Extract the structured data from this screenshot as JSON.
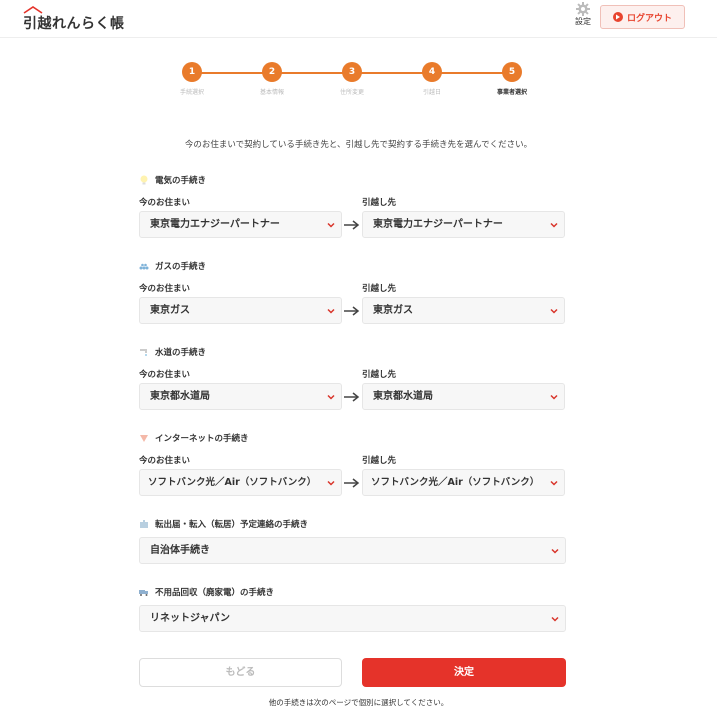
{
  "header": {
    "logo_text": "引越れんらく帳",
    "settings_label": "設定",
    "logout_label": "ログアウト"
  },
  "stepper": {
    "steps": [
      {
        "number": "1",
        "label": "手続選択"
      },
      {
        "number": "2",
        "label": "基本情報"
      },
      {
        "number": "3",
        "label": "住所変更"
      },
      {
        "number": "4",
        "label": "引越日"
      },
      {
        "number": "5",
        "label": "事業者選択"
      }
    ],
    "current": 5,
    "accent": "#e97b2b"
  },
  "intro": "今のお住まいで契約している手続き先と、引越し先で契約する手続き先を選んでください。",
  "labels": {
    "current": "今のお住まい",
    "new": "引越し先"
  },
  "sections": {
    "electricity": {
      "title": "電気の手続き",
      "current": "東京電力エナジーパートナー",
      "new": "東京電力エナジーパートナー"
    },
    "gas": {
      "title": "ガスの手続き",
      "current": "東京ガス",
      "new": "東京ガス"
    },
    "water": {
      "title": "水道の手続き",
      "current": "東京都水道局",
      "new": "東京都水道局"
    },
    "internet": {
      "title": "インターネットの手続き",
      "current": "ソフトバンク光／Air（ソフトバンク）",
      "new": "ソフトバンク光／Air（ソフトバンク）"
    },
    "municipal": {
      "title": "転出届・転入（転居）予定連絡の手続き",
      "value": "自治体手続き"
    },
    "disposal": {
      "title": "不用品回収（廃家電）の手続き",
      "value": "リネットジャパン"
    }
  },
  "buttons": {
    "back": "もどる",
    "submit": "決定"
  },
  "footnote": "他の手続きは次のページで個別に選択してください。",
  "colors": {
    "primary_red": "#e5332a",
    "chevron_red": "#d9352b",
    "step_orange": "#e97b2b"
  }
}
